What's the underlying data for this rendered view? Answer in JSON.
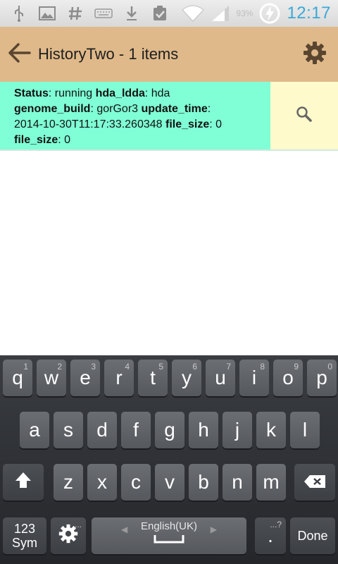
{
  "status_bar": {
    "icons": [
      "usb-icon",
      "image-icon",
      "hash-icon",
      "keyboard-icon",
      "download-icon",
      "clipboard-icon",
      "wifi-icon",
      "signal-icon",
      "battery-charging-icon"
    ],
    "battery_text": "93%",
    "time": "12:17"
  },
  "action_bar": {
    "title": "HistoryTwo - 1 items",
    "back_icon": "back-arrow-icon",
    "settings_icon": "gear-icon",
    "background": "#dfb98a"
  },
  "dataset": {
    "status_label": "Status",
    "status_value": "running",
    "hda_label": "hda_ldda",
    "hda_value": "hda",
    "genome_label": "genome_build",
    "genome_value": "gorGor3",
    "update_label": "update_time",
    "update_value": "2014-10-30T11:17:33.260348",
    "size_label": "file_size",
    "size_value": "0",
    "size2_label": "file_size",
    "size2_value": "0",
    "background": "#80ffd6",
    "search_icon": "magnifier-icon",
    "search_background": "#fffacc"
  },
  "keyboard": {
    "row1": [
      {
        "label": "q",
        "hint": "1"
      },
      {
        "label": "w",
        "hint": "2"
      },
      {
        "label": "e",
        "hint": "3"
      },
      {
        "label": "r",
        "hint": "4"
      },
      {
        "label": "t",
        "hint": "5"
      },
      {
        "label": "y",
        "hint": "6"
      },
      {
        "label": "u",
        "hint": "7"
      },
      {
        "label": "i",
        "hint": "8"
      },
      {
        "label": "o",
        "hint": "9"
      },
      {
        "label": "p",
        "hint": "0"
      }
    ],
    "row2": [
      "a",
      "s",
      "d",
      "f",
      "g",
      "h",
      "j",
      "k",
      "l"
    ],
    "row3": [
      "z",
      "x",
      "c",
      "v",
      "b",
      "n",
      "m"
    ],
    "sym_top": "123",
    "sym_bottom": "Sym",
    "settings_hint": "...",
    "space_label": "English(UK)",
    "period_label": ".",
    "period_hint": "...?",
    "done_label": "Done"
  }
}
